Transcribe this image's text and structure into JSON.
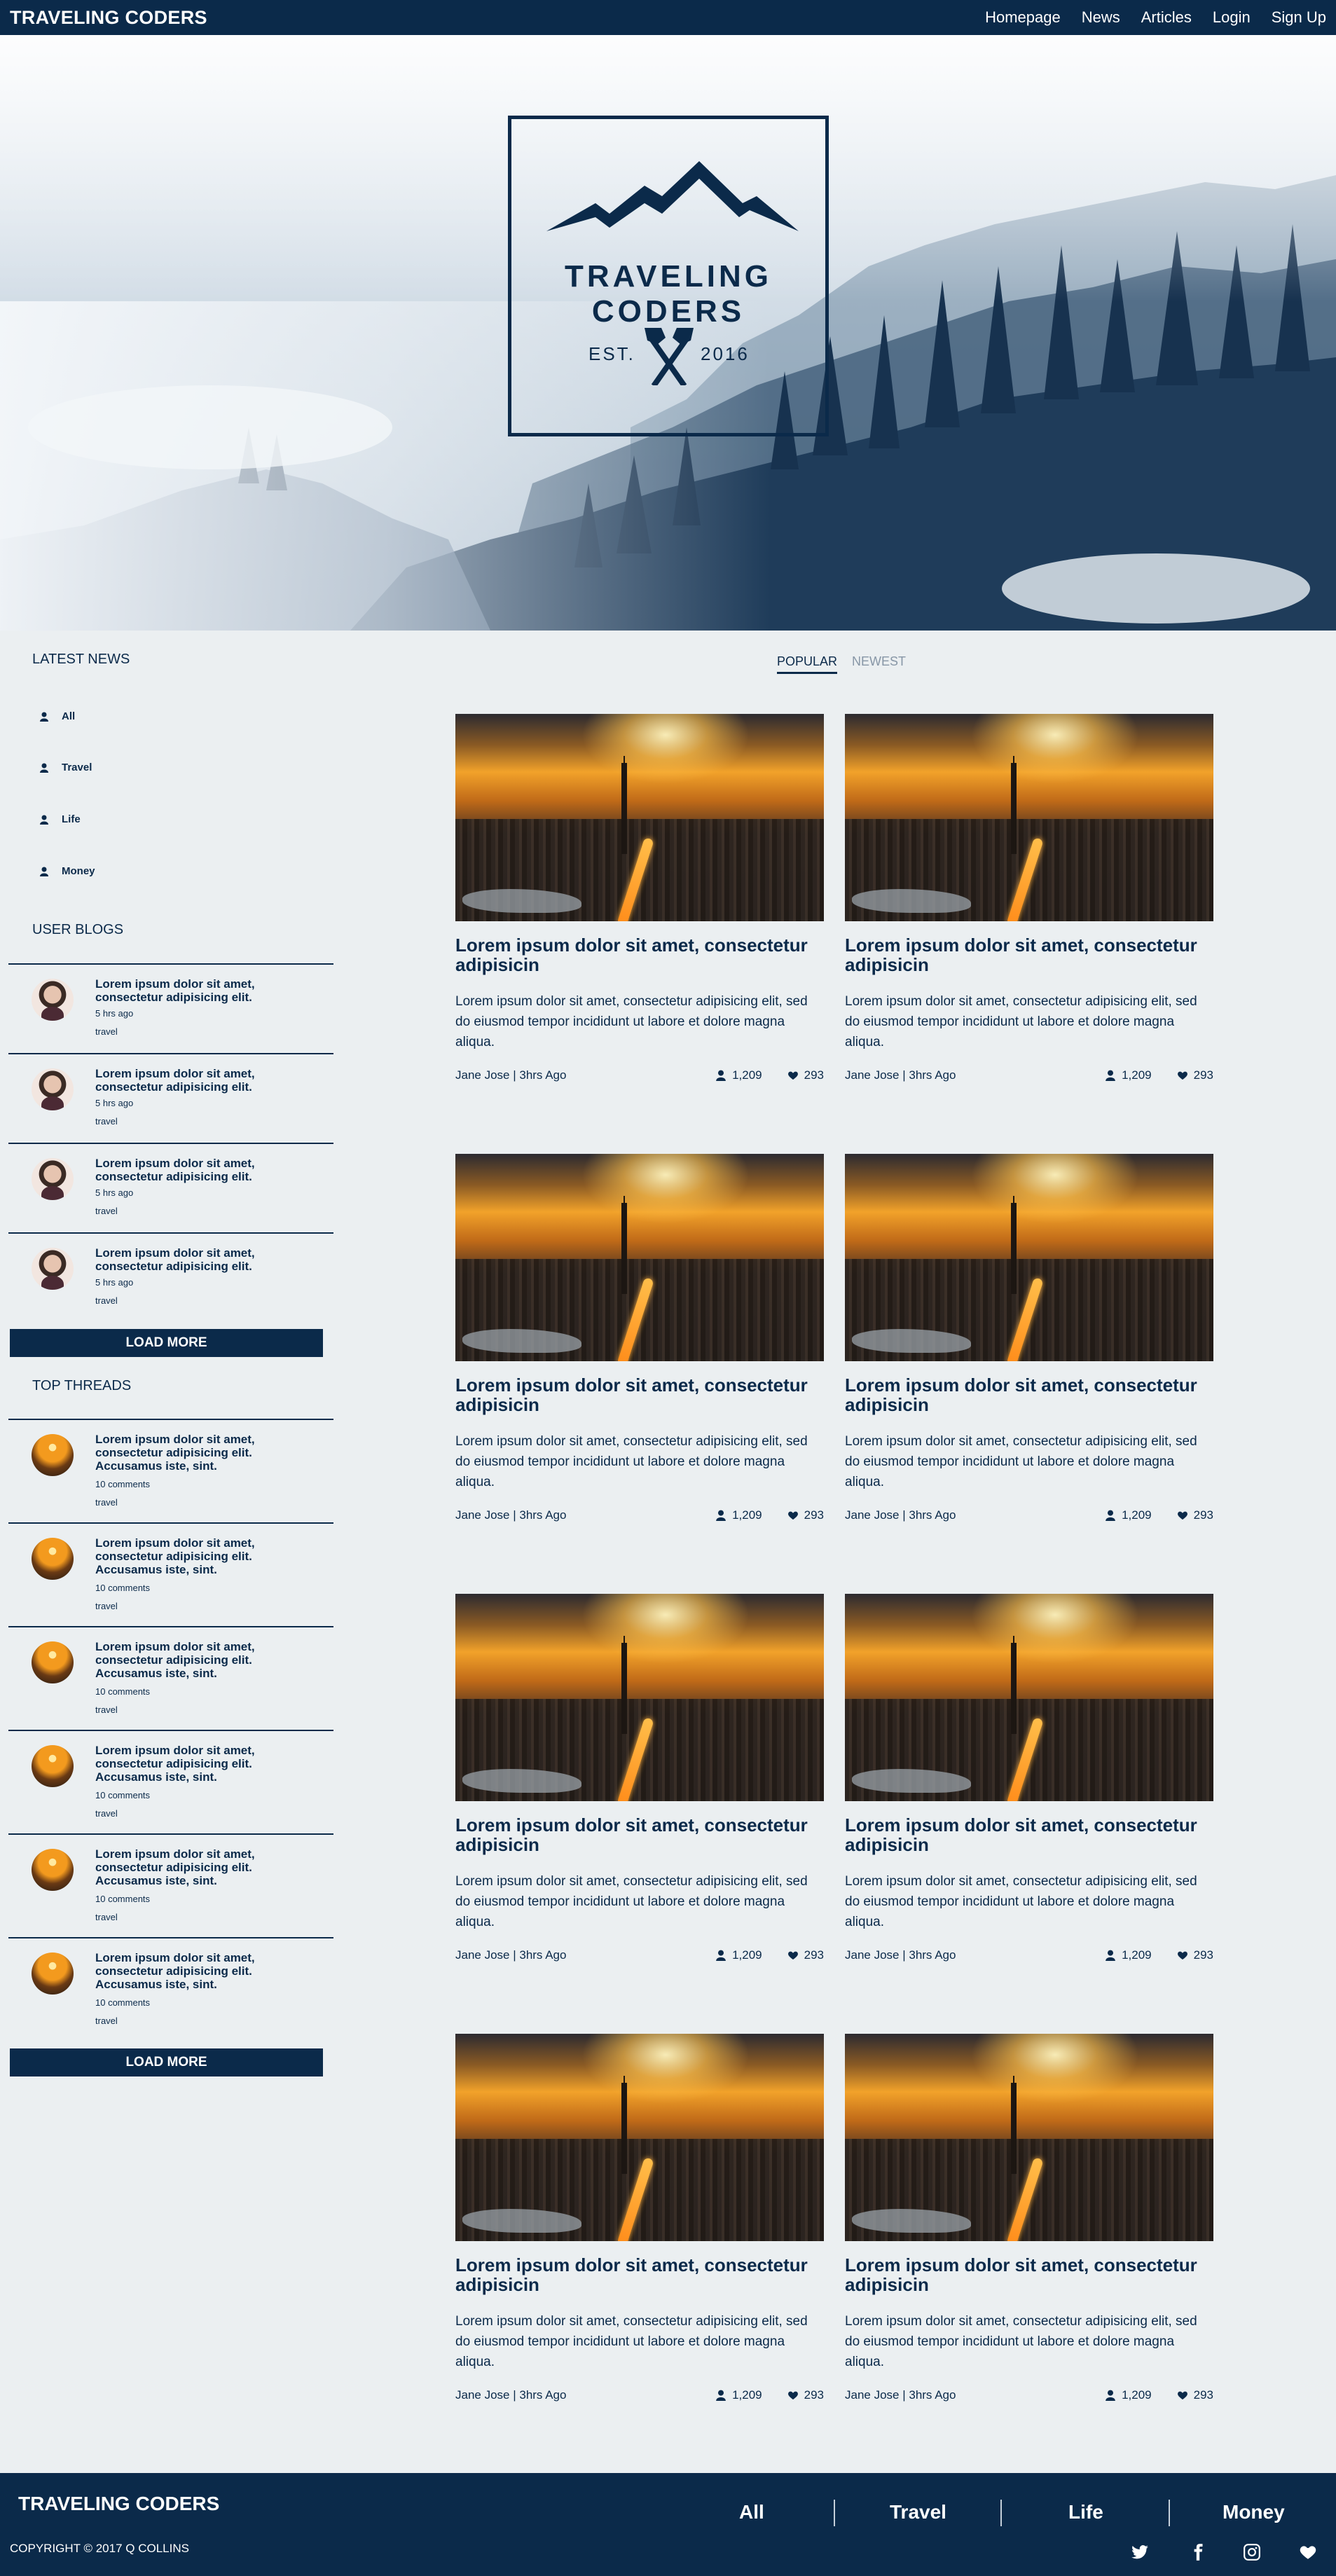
{
  "nav": {
    "brand": "TRAVELING CODERS",
    "links": [
      "Homepage",
      "News",
      "Articles",
      "Login",
      "Sign Up"
    ]
  },
  "hero": {
    "logo_title": "TRAVELING CODERS",
    "est": "EST.",
    "year": "2016"
  },
  "sidebar": {
    "latest_news_heading": "LATEST NEWS",
    "categories": [
      "All",
      "Travel",
      "Life",
      "Money"
    ],
    "user_blogs_heading": "USER BLOGS",
    "user_blogs": [
      {
        "title": "Lorem ipsum dolor sit amet, consectetur adipisicing elit.",
        "time": "5 hrs ago",
        "tag": "travel"
      },
      {
        "title": "Lorem ipsum dolor sit amet, consectetur adipisicing elit.",
        "time": "5 hrs ago",
        "tag": "travel"
      },
      {
        "title": "Lorem ipsum dolor sit amet, consectetur adipisicing elit.",
        "time": "5 hrs ago",
        "tag": "travel"
      },
      {
        "title": "Lorem ipsum dolor sit amet, consectetur adipisicing elit.",
        "time": "5 hrs ago",
        "tag": "travel"
      }
    ],
    "load_more": "LOAD MORE",
    "top_threads_heading": "TOP THREADS",
    "top_threads": [
      {
        "title": "Lorem ipsum dolor sit amet, consectetur adipisicing elit. Accusamus iste, sint.",
        "comments": "10 comments",
        "tag": "travel"
      },
      {
        "title": "Lorem ipsum dolor sit amet, consectetur adipisicing elit. Accusamus iste, sint.",
        "comments": "10 comments",
        "tag": "travel"
      },
      {
        "title": "Lorem ipsum dolor sit amet, consectetur adipisicing elit. Accusamus iste, sint.",
        "comments": "10 comments",
        "tag": "travel"
      },
      {
        "title": "Lorem ipsum dolor sit amet, consectetur adipisicing elit. Accusamus iste, sint.",
        "comments": "10 comments",
        "tag": "travel"
      },
      {
        "title": "Lorem ipsum dolor sit amet, consectetur adipisicing elit. Accusamus iste, sint.",
        "comments": "10 comments",
        "tag": "travel"
      },
      {
        "title": "Lorem ipsum dolor sit amet, consectetur adipisicing elit. Accusamus iste, sint.",
        "comments": "10 comments",
        "tag": "travel"
      }
    ],
    "load_more_2": "LOAD MORE"
  },
  "tabs": [
    "POPULAR",
    "NEWEST"
  ],
  "articles": [
    {
      "title": "Lorem ipsum dolor sit amet, consectetur adipisicin",
      "desc": "Lorem ipsum dolor sit amet, consectetur adipisicing elit, sed do eiusmod tempor incididunt ut labore et dolore magna aliqua.",
      "byline": "Jane Jose | 3hrs Ago",
      "views": "1,209",
      "likes": "293"
    },
    {
      "title": "Lorem ipsum dolor sit amet, consectetur adipisicin",
      "desc": "Lorem ipsum dolor sit amet, consectetur adipisicing elit, sed do eiusmod tempor incididunt ut labore et dolore magna aliqua.",
      "byline": "Jane Jose | 3hrs Ago",
      "views": "1,209",
      "likes": "293"
    },
    {
      "title": "Lorem ipsum dolor sit amet, consectetur adipisicin",
      "desc": "Lorem ipsum dolor sit amet, consectetur adipisicing elit, sed do eiusmod tempor incididunt ut labore et dolore magna aliqua.",
      "byline": "Jane Jose | 3hrs Ago",
      "views": "1,209",
      "likes": "293"
    },
    {
      "title": "Lorem ipsum dolor sit amet, consectetur adipisicin",
      "desc": "Lorem ipsum dolor sit amet, consectetur adipisicing elit, sed do eiusmod tempor incididunt ut labore et dolore magna aliqua.",
      "byline": "Jane Jose | 3hrs Ago",
      "views": "1,209",
      "likes": "293"
    },
    {
      "title": "Lorem ipsum dolor sit amet, consectetur adipisicin",
      "desc": "Lorem ipsum dolor sit amet, consectetur adipisicing elit, sed do eiusmod tempor incididunt ut labore et dolore magna aliqua.",
      "byline": "Jane Jose | 3hrs Ago",
      "views": "1,209",
      "likes": "293"
    },
    {
      "title": "Lorem ipsum dolor sit amet, consectetur adipisicin",
      "desc": "Lorem ipsum dolor sit amet, consectetur adipisicing elit, sed do eiusmod tempor incididunt ut labore et dolore magna aliqua.",
      "byline": "Jane Jose | 3hrs Ago",
      "views": "1,209",
      "likes": "293"
    },
    {
      "title": "Lorem ipsum dolor sit amet, consectetur adipisicin",
      "desc": "Lorem ipsum dolor sit amet, consectetur adipisicing elit, sed do eiusmod tempor incididunt ut labore et dolore magna aliqua.",
      "byline": "Jane Jose | 3hrs Ago",
      "views": "1,209",
      "likes": "293"
    },
    {
      "title": "Lorem ipsum dolor sit amet, consectetur adipisicin",
      "desc": "Lorem ipsum dolor sit amet, consectetur adipisicing elit, sed do eiusmod tempor incididunt ut labore et dolore magna aliqua.",
      "byline": "Jane Jose | 3hrs Ago",
      "views": "1,209",
      "likes": "293"
    }
  ],
  "footer": {
    "brand": "TRAVELING CODERS",
    "copyright": "COPYRIGHT © 2017 Q COLLINS",
    "categories": [
      "All",
      "Travel",
      "Life",
      "Money"
    ],
    "social_icons": [
      "twitter-icon",
      "facebook-icon",
      "instagram-icon",
      "heart-icon"
    ]
  },
  "colors": {
    "navy": "#0b2a4a",
    "background": "#ebeff1",
    "muted_tab": "#8796a6"
  }
}
